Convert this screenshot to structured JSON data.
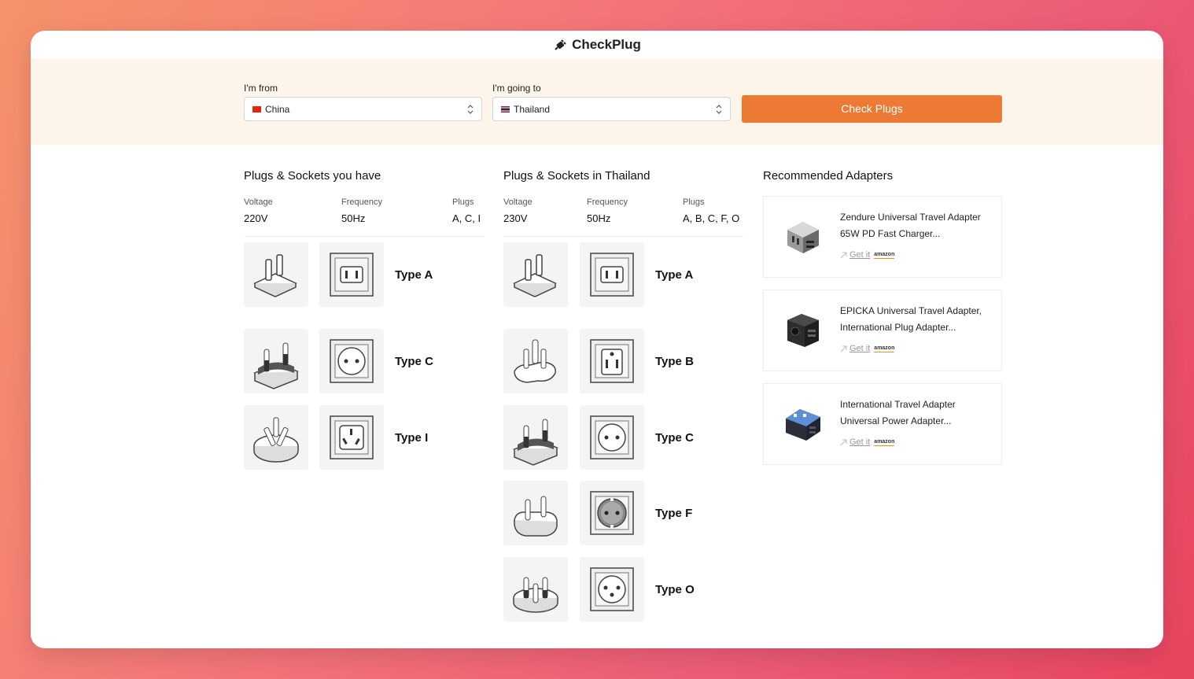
{
  "app": {
    "name": "CheckPlug",
    "icon": "plug-icon"
  },
  "form": {
    "from_label": "I'm from",
    "from_value": "China",
    "to_label": "I'm going to",
    "to_value": "Thailand",
    "check_button": "Check Plugs"
  },
  "have": {
    "title": "Plugs & Sockets you have",
    "voltage_label": "Voltage",
    "voltage": "220V",
    "frequency_label": "Frequency",
    "frequency": "50Hz",
    "plugs_label": "Plugs",
    "plugs": "A, C, I",
    "types": [
      "Type A",
      "Type C",
      "Type I"
    ]
  },
  "dest": {
    "title": "Plugs & Sockets in Thailand",
    "voltage_label": "Voltage",
    "voltage": "230V",
    "frequency_label": "Frequency",
    "frequency": "50Hz",
    "plugs_label": "Plugs",
    "plugs": "A, B, C, F, O",
    "types": [
      "Type A",
      "Type B",
      "Type C",
      "Type F",
      "Type O"
    ]
  },
  "adapters": {
    "title": "Recommended Adapters",
    "items": [
      {
        "title": "Zendure Universal Travel Adapter 65W PD Fast Charger...",
        "link": "Get it",
        "store": "amazon"
      },
      {
        "title": "EPICKA Universal Travel Adapter, International Plug Adapter...",
        "link": "Get it",
        "store": "amazon"
      },
      {
        "title": "International Travel Adapter Universal Power Adapter...",
        "link": "Get it",
        "store": "amazon"
      }
    ]
  },
  "colors": {
    "accent": "#ec7a34",
    "band": "#fdf4ea"
  }
}
